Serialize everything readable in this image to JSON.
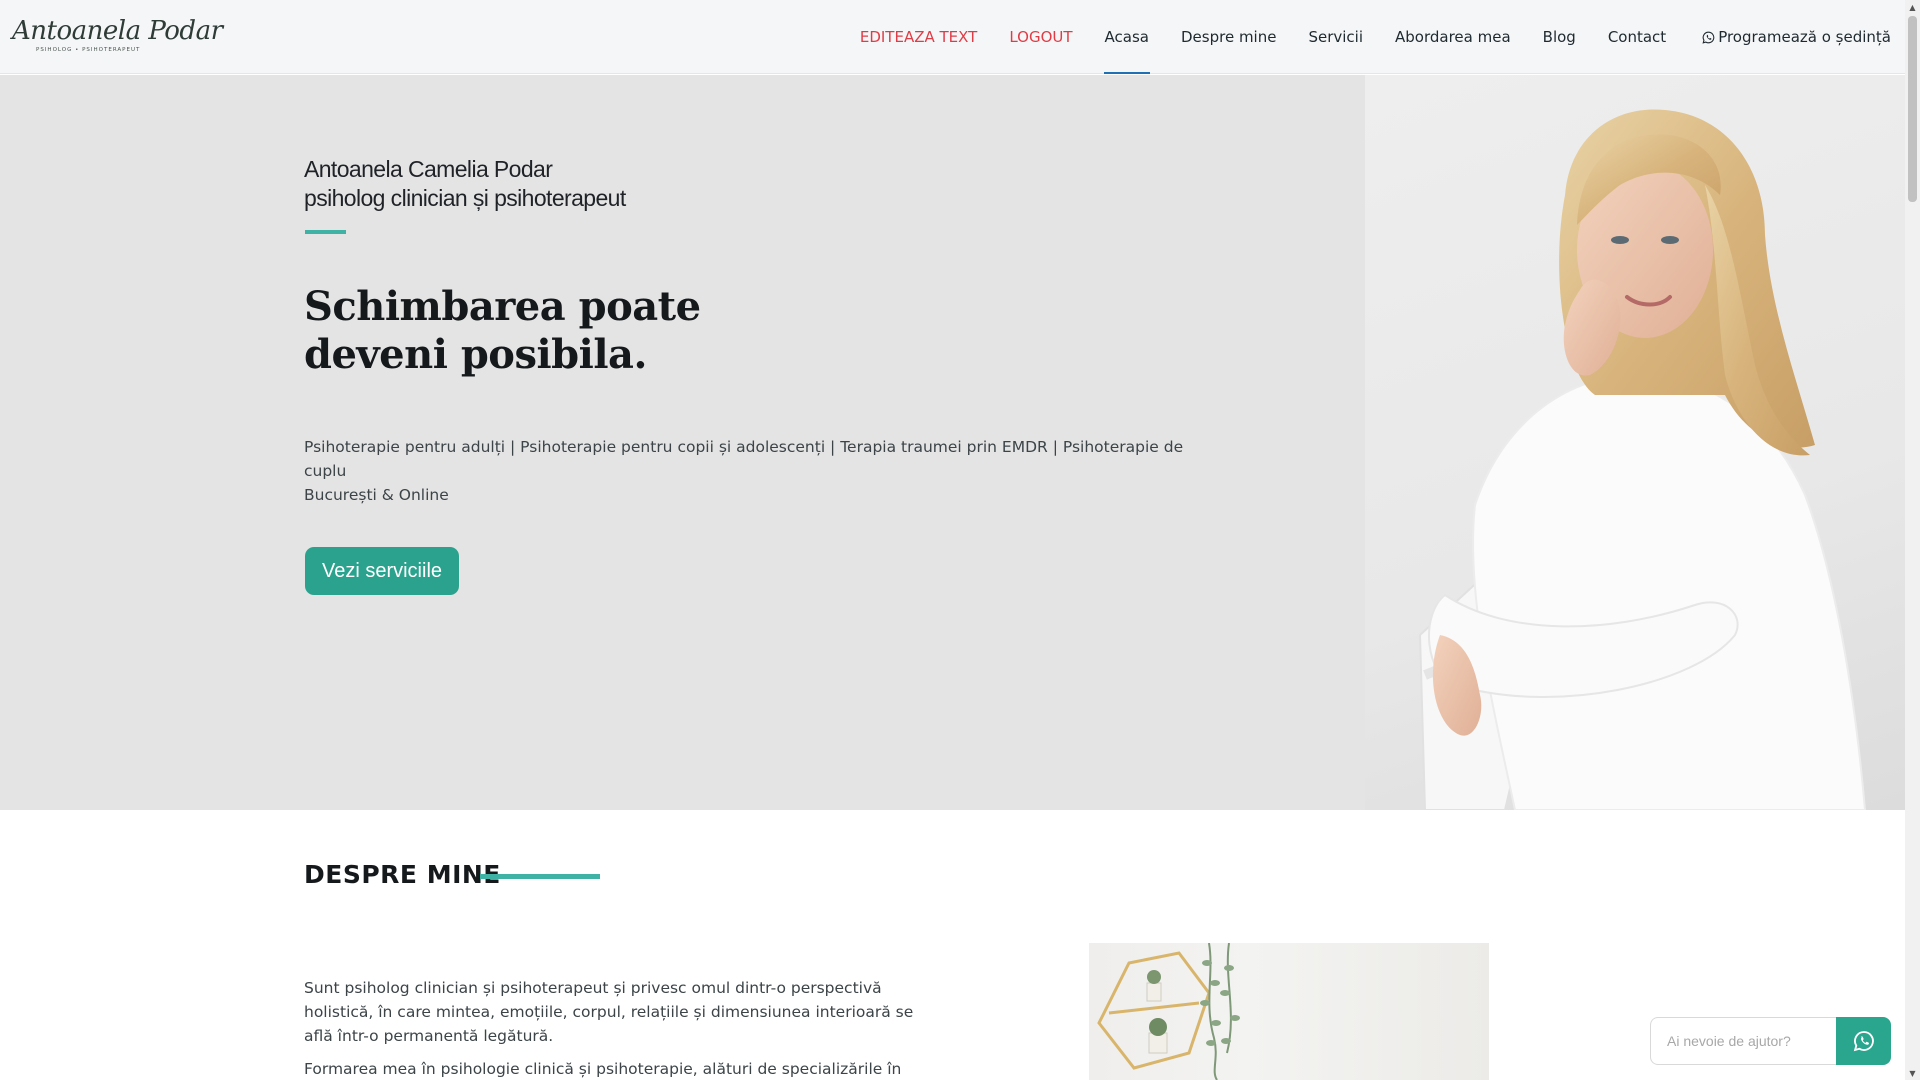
{
  "header": {
    "logo": {
      "script": "Antoanela Podar",
      "tagline": "PSIHOLOG • PSIHOTERAPEUT"
    },
    "nav": [
      {
        "label": "EDITEAZA TEXT"
      },
      {
        "label": "LOGOUT"
      },
      {
        "label": "Acasa"
      },
      {
        "label": "Despre mine"
      },
      {
        "label": "Servicii"
      },
      {
        "label": "Abordarea mea"
      },
      {
        "label": "Blog"
      },
      {
        "label": "Contact"
      }
    ],
    "booking_label": "Programează o ședință",
    "booking_icon": "whatsapp-icon"
  },
  "hero": {
    "name_line1": "Antoanela Camelia Podar",
    "name_line2": "psiholog clinician și psihoterapeut",
    "title_line1": "Schimbarea poate",
    "title_line2": "deveni posibila.",
    "subtitle_line1": "Psihoterapie pentru adulți | Psihoterapie pentru copii și adolescenți | Terapia traumei prin EMDR | Psihoterapie de cuplu",
    "subtitle_line2": "București & Online",
    "button_label": "Vezi serviciile",
    "accent_color": "#2ba28d"
  },
  "about": {
    "title": "DESPRE MINE",
    "paragraph1": "Sunt psiholog clinician și psihoterapeut și privesc omul dintr-o perspectivă holistică, în care mintea, emoțiile, corpul, relațiile și dimensiunea interioară se află într-o permanentă legătură.",
    "paragraph2": "Formarea mea în psihologie clinică și psihoterapie, alături de specializările în terapia"
  },
  "help_widget": {
    "placeholder": "Ai nevoie de ajutor?",
    "icon": "whatsapp-icon"
  }
}
